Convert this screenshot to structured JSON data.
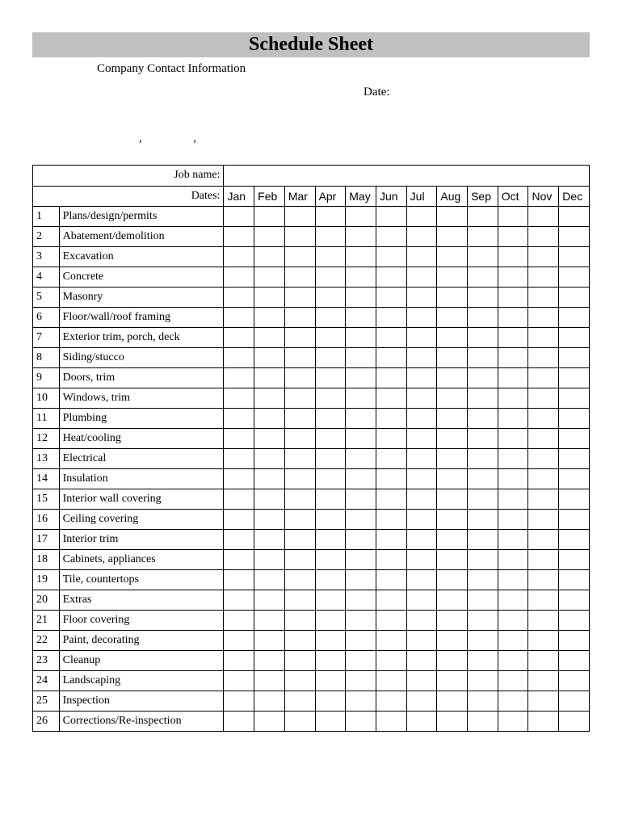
{
  "title": "Schedule Sheet",
  "header": {
    "company_contact": "Company Contact Information",
    "date_label": "Date:",
    "punct1": ",",
    "punct2": ","
  },
  "labels": {
    "job_name": "Job name:",
    "dates": "Dates:"
  },
  "months": [
    "Jan",
    "Feb",
    "Mar",
    "Apr",
    "May",
    "Jun",
    "Jul",
    "Aug",
    "Sep",
    "Oct",
    "Nov",
    "Dec"
  ],
  "tasks": [
    {
      "num": "1",
      "name": "Plans/design/permits"
    },
    {
      "num": "2",
      "name": "Abatement/demolition"
    },
    {
      "num": "3",
      "name": "Excavation"
    },
    {
      "num": "4",
      "name": "Concrete"
    },
    {
      "num": "5",
      "name": "Masonry"
    },
    {
      "num": "6",
      "name": "Floor/wall/roof framing"
    },
    {
      "num": "7",
      "name": "Exterior trim, porch, deck"
    },
    {
      "num": "8",
      "name": "Siding/stucco"
    },
    {
      "num": "9",
      "name": "Doors, trim"
    },
    {
      "num": "10",
      "name": "Windows, trim"
    },
    {
      "num": "11",
      "name": "Plumbing"
    },
    {
      "num": "12",
      "name": "Heat/cooling"
    },
    {
      "num": "13",
      "name": "Electrical"
    },
    {
      "num": "14",
      "name": "Insulation"
    },
    {
      "num": "15",
      "name": "Interior wall covering"
    },
    {
      "num": "16",
      "name": "Ceiling covering"
    },
    {
      "num": "17",
      "name": "Interior trim"
    },
    {
      "num": "18",
      "name": "Cabinets, appliances"
    },
    {
      "num": "19",
      "name": "Tile, countertops"
    },
    {
      "num": "20",
      "name": "Extras"
    },
    {
      "num": "21",
      "name": "Floor covering"
    },
    {
      "num": "22",
      "name": "Paint, decorating"
    },
    {
      "num": "23",
      "name": "Cleanup"
    },
    {
      "num": "24",
      "name": "Landscaping"
    },
    {
      "num": "25",
      "name": "Inspection"
    },
    {
      "num": "26",
      "name": "Corrections/Re-inspection"
    }
  ]
}
